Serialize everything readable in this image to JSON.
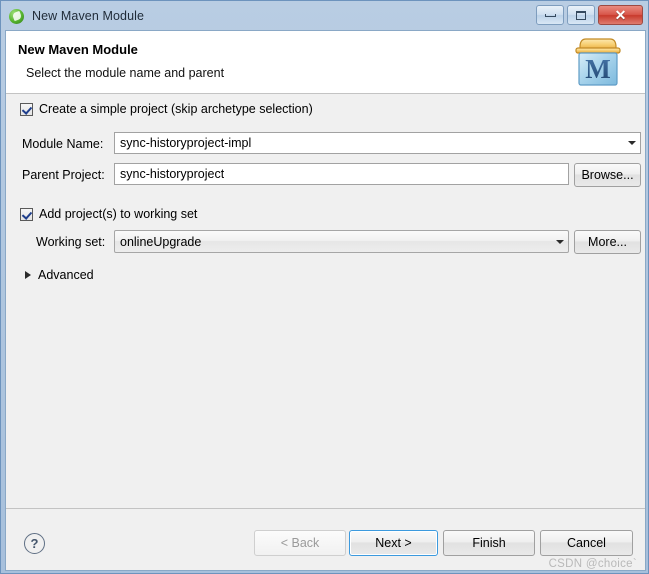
{
  "window": {
    "title": "New Maven Module",
    "icon": "eclipse-leaf-icon",
    "controls": {
      "minimize": "minimize-icon",
      "maximize": "maximize-icon",
      "close": "✕"
    }
  },
  "banner": {
    "title": "New Maven Module",
    "subtitle": "Select the module name and parent",
    "icon": "maven-module-icon",
    "icon_letter": "M"
  },
  "form": {
    "simple_project": {
      "label": "Create a simple project (skip archetype selection)",
      "checked": true
    },
    "module_name": {
      "label": "Module Name:",
      "value": "sync-historyproject-impl"
    },
    "parent_project": {
      "label": "Parent Project:",
      "value": "sync-historyproject",
      "browse_label": "Browse..."
    },
    "add_to_working_set": {
      "label": "Add project(s) to working set",
      "checked": true
    },
    "working_set": {
      "label": "Working set:",
      "value": "onlineUpgrade",
      "more_label": "More..."
    },
    "advanced": {
      "label": "Advanced",
      "expanded": false
    }
  },
  "footer": {
    "help": "?",
    "back_label": "< Back",
    "next_label": "Next >",
    "finish_label": "Finish",
    "cancel_label": "Cancel",
    "watermark": "CSDN @choice`"
  },
  "colors": {
    "titlebar": "#aec5de",
    "frame_border": "#6d93bd",
    "dialog_bg": "#f0f0f0",
    "banner_bg": "#ffffff",
    "default_button_border": "#3c9ade",
    "close_button": "#c8392c",
    "checkmark": "#1e3e8c"
  }
}
